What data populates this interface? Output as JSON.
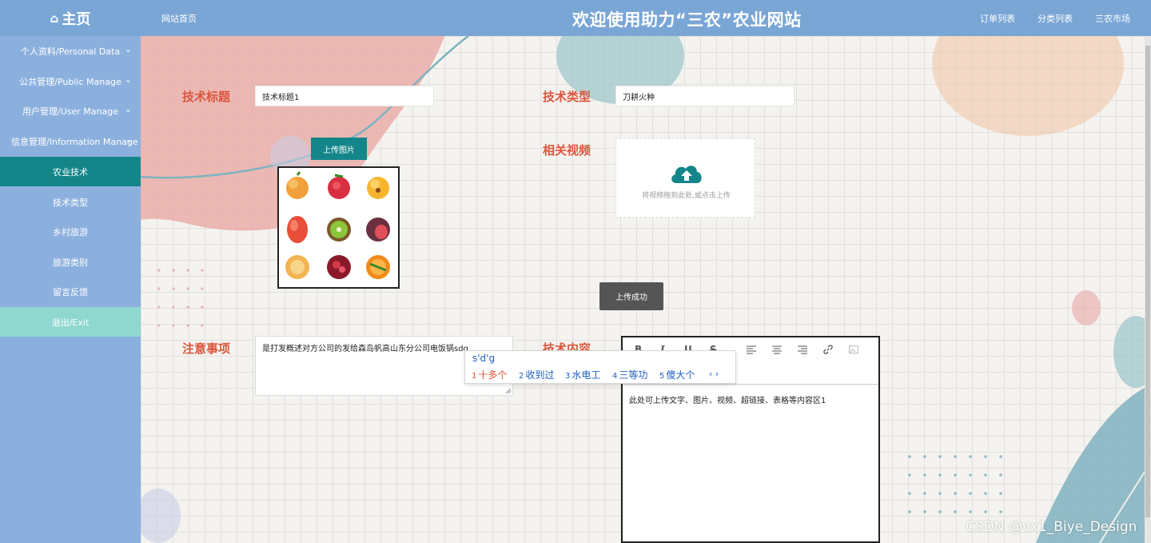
{
  "header": {
    "brand": "主页",
    "nav_home": "网站首页",
    "title": "欢迎使用助力“三农”农业网站",
    "nav_right": [
      "订单列表",
      "分类列表",
      "三农市场"
    ]
  },
  "sidebar": {
    "items": [
      {
        "label": "个人资料/Personal Data"
      },
      {
        "label": "公共管理/Public Manage"
      },
      {
        "label": "用户管理/User Manage"
      },
      {
        "label": "信息管理/Information Manage"
      },
      {
        "label": "农业技术"
      },
      {
        "label": "技术类型"
      },
      {
        "label": "乡村旅游"
      },
      {
        "label": "旅游类别"
      },
      {
        "label": "留言反馈"
      },
      {
        "label": "退出/Exit"
      }
    ]
  },
  "form": {
    "title_label": "技术标题",
    "title_value": "技术标题1",
    "type_label": "技术类型",
    "type_value": "刀耕火种",
    "upload_image_button": "上传图片",
    "video_label": "相关视频",
    "video_hint": "将视频拖到此处,或点击上传",
    "toast": "上传成功",
    "notes_label": "注意事项",
    "notes_value": "是打发概述对方公司的发给森岛帆高山东分公司电饭锅sdg",
    "content_label": "技术内容",
    "content_value": "此处可上传文字、图片、视频、超链接、表格等内容区1"
  },
  "ime": {
    "composition": "s'd'g",
    "candidates": [
      {
        "n": "1",
        "text": "十多个"
      },
      {
        "n": "2",
        "text": "收到过"
      },
      {
        "n": "3",
        "text": "水电工"
      },
      {
        "n": "4",
        "text": "三等功"
      },
      {
        "n": "5",
        "text": "傻大个"
      }
    ],
    "arrows": "‹ ›"
  },
  "toolbar": {
    "bold": "B",
    "italic": "I",
    "underline": "U",
    "strike": "S"
  },
  "watermark": "CSDN @vx1_Biye_Design",
  "colors": {
    "header": "#7aa6d6",
    "sidebar": "#8cb0de",
    "active": "#14868a",
    "exit": "#8ed8d0",
    "label": "#d9573e"
  }
}
